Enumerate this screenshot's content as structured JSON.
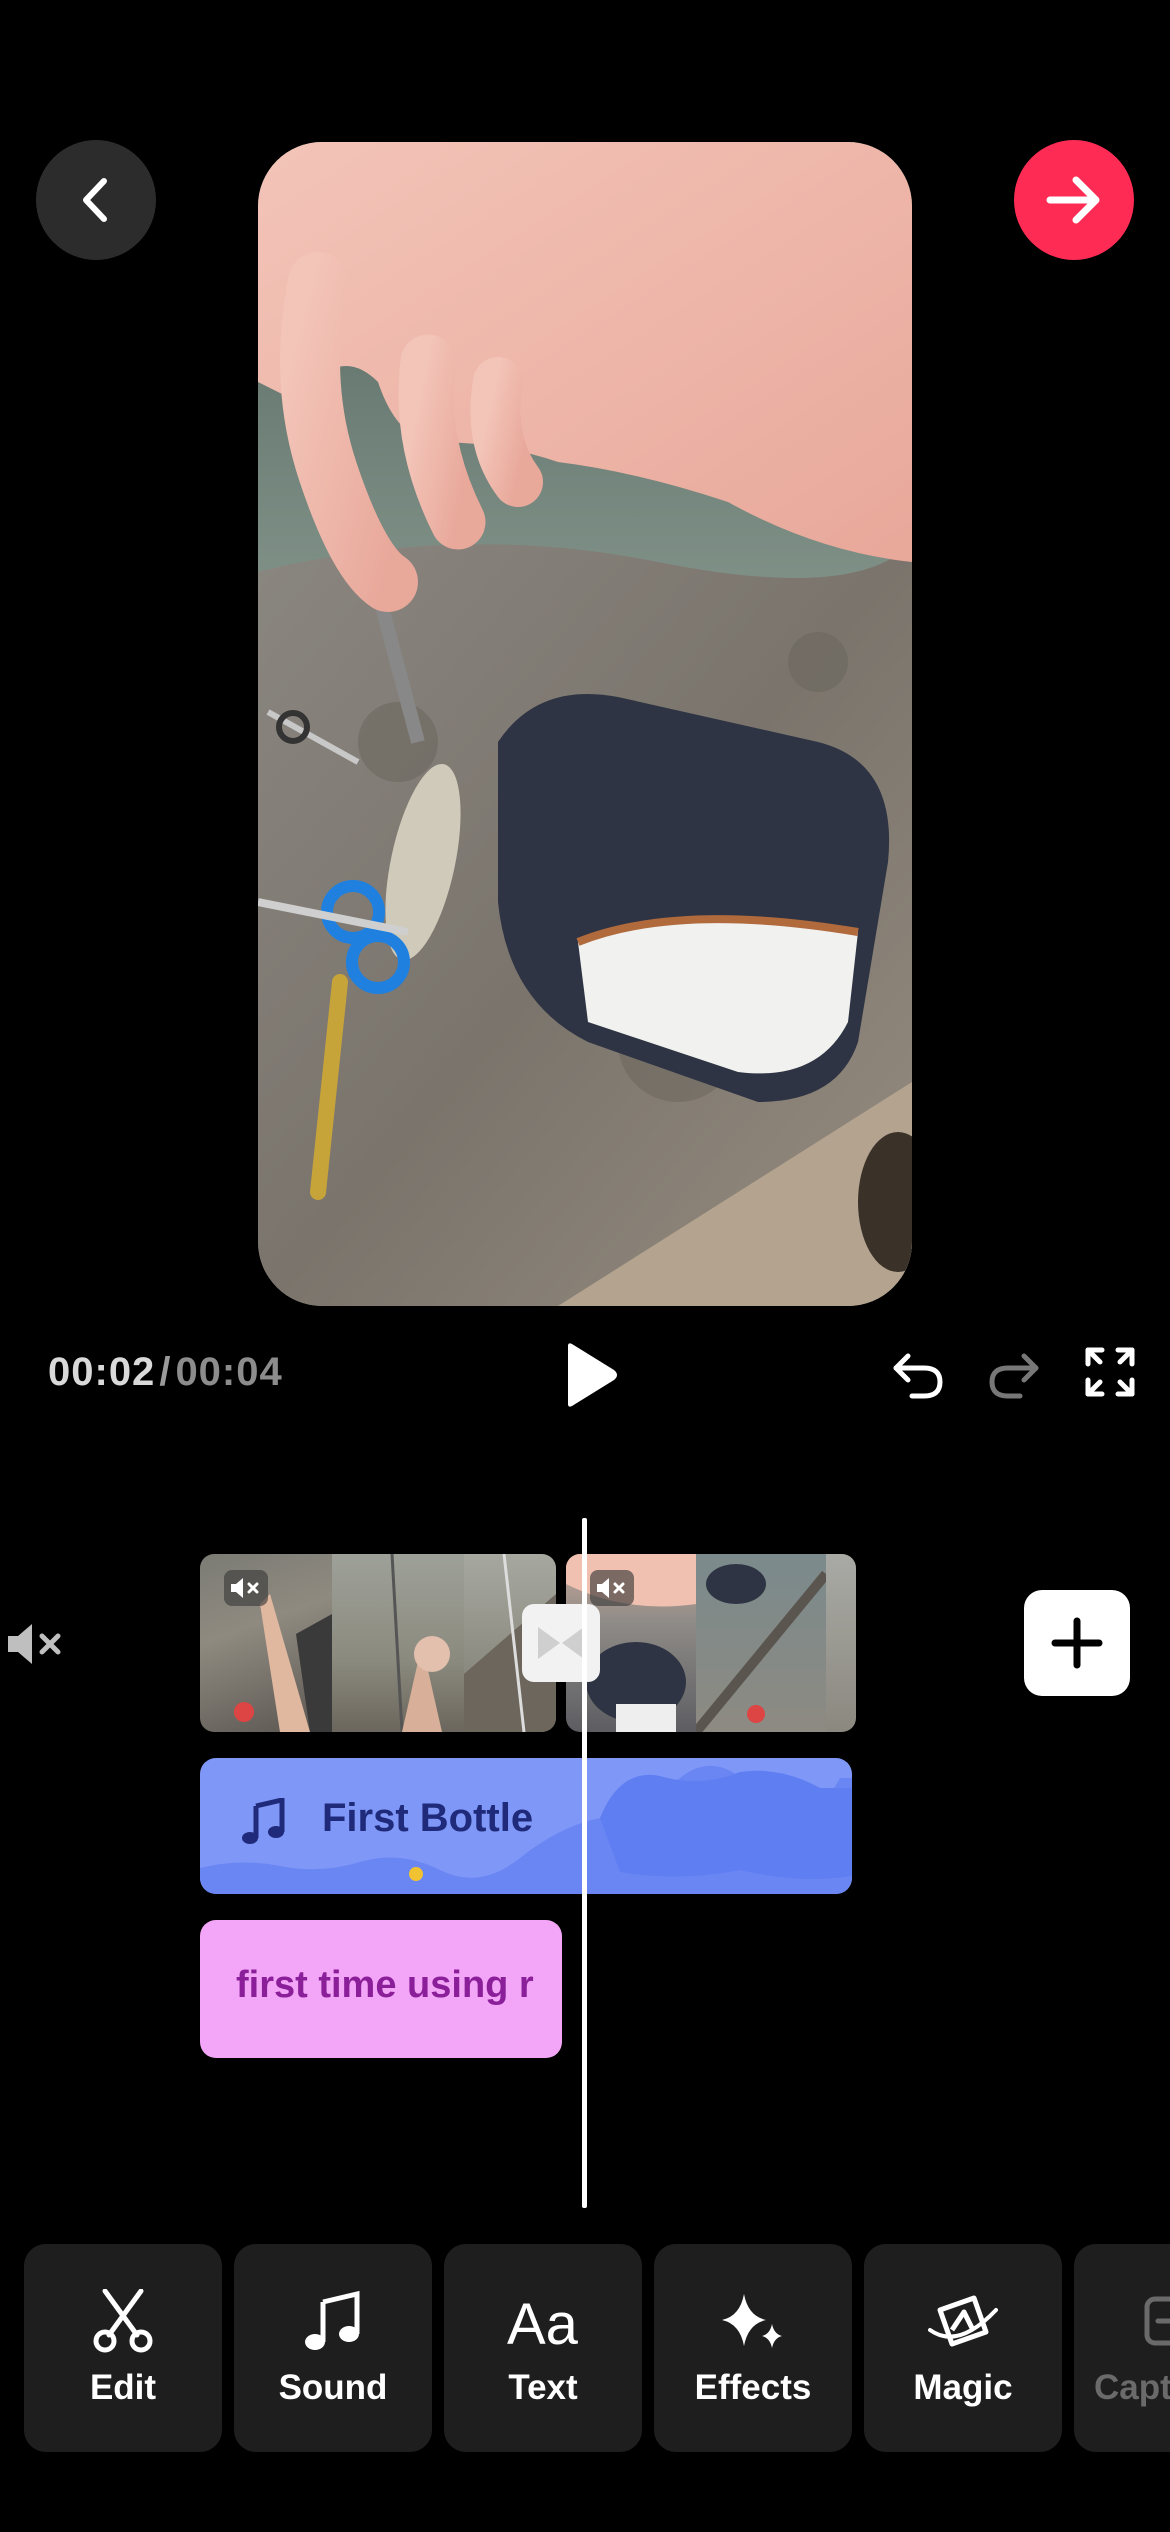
{
  "playback": {
    "current_time": "00:02",
    "separator": "/",
    "duration": "00:04"
  },
  "tracks": {
    "sound_title": "First Bottle",
    "text_caption": "first time using r"
  },
  "toolbar": {
    "items": [
      {
        "label": "Edit",
        "icon": "scissors-icon"
      },
      {
        "label": "Sound",
        "icon": "music-note-icon"
      },
      {
        "label": "Text",
        "icon": "text-aa-icon"
      },
      {
        "label": "Effects",
        "icon": "sparkle-icon"
      },
      {
        "label": "Magic",
        "icon": "magic-icon"
      },
      {
        "label": "Capt",
        "icon": "captions-icon"
      }
    ]
  },
  "colors": {
    "accent": "#fe2c55",
    "sound_track": "#7f97f7",
    "text_track": "#f3a6f7"
  }
}
